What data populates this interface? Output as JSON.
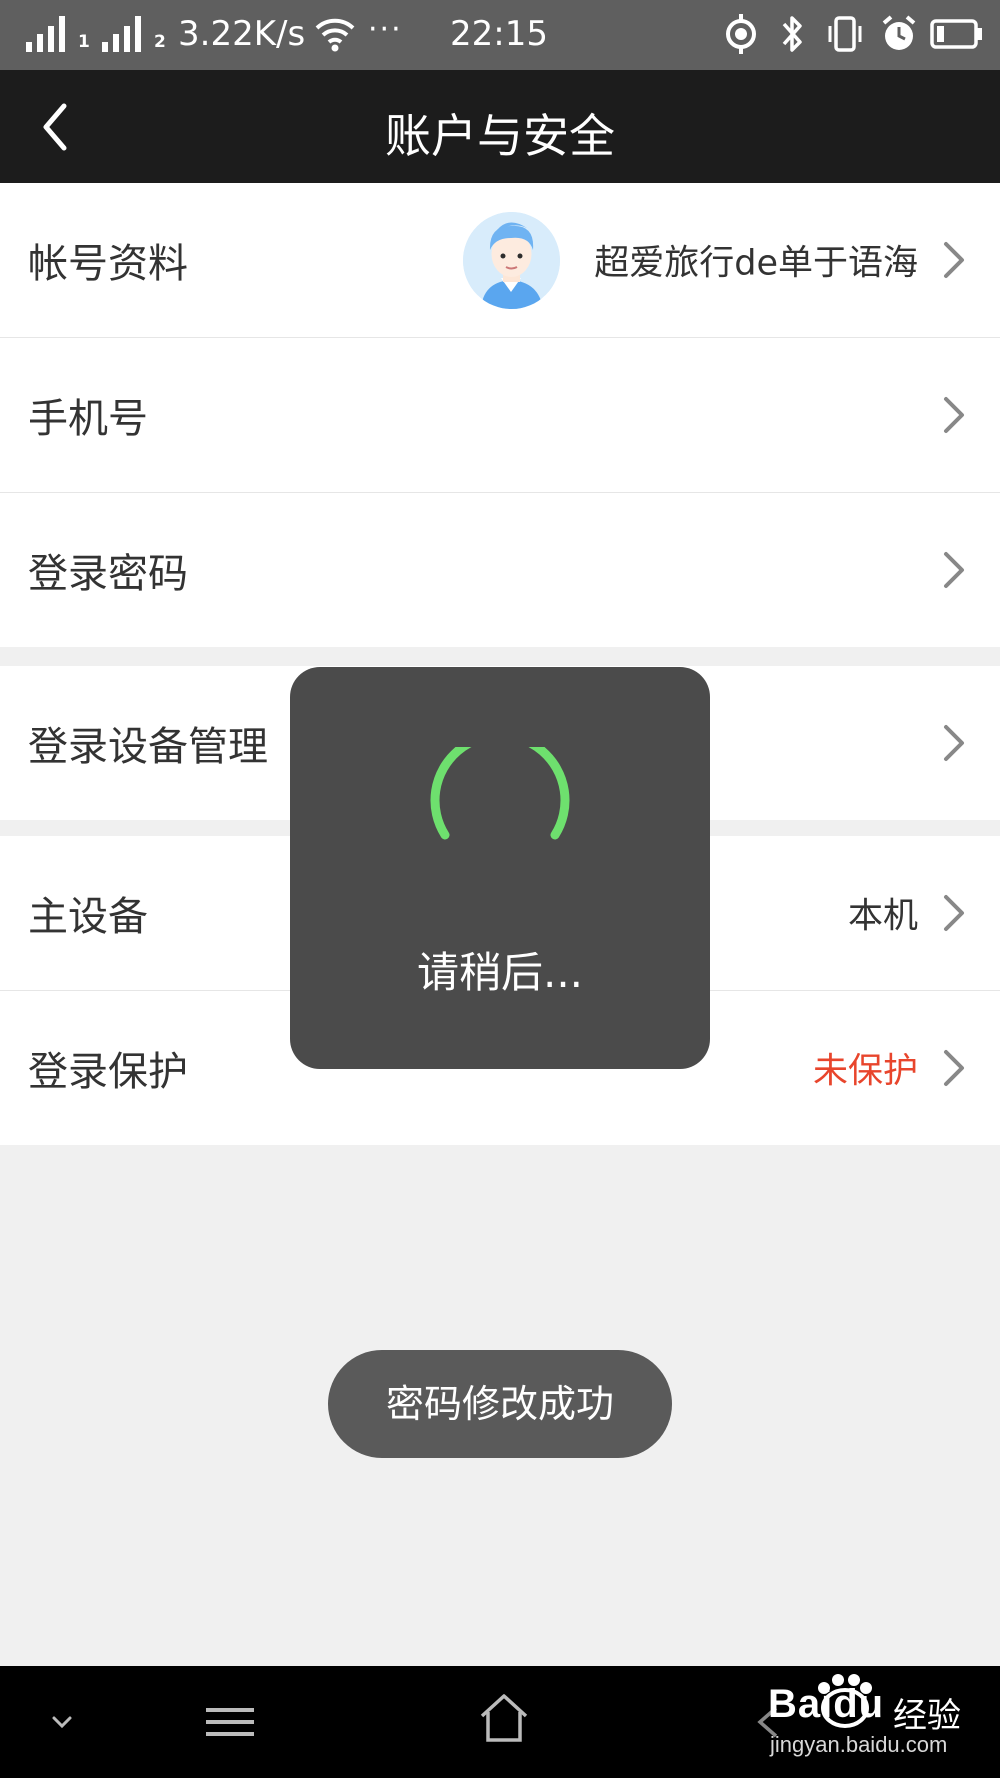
{
  "status_bar": {
    "sim1": "1",
    "sim2": "2",
    "net_speed": "3.22K/s",
    "more": "···",
    "time": "22:15"
  },
  "nav": {
    "title": "账户与安全"
  },
  "rows": [
    {
      "label": "帐号资料",
      "value": "超爱旅行de单于语海"
    },
    {
      "label": "手机号",
      "value": ""
    },
    {
      "label": "登录密码",
      "value": ""
    },
    {
      "label": "登录设备管理",
      "value": ""
    },
    {
      "label": "主设备",
      "value": "本机"
    },
    {
      "label": "登录保护",
      "value": "未保护"
    }
  ],
  "loading": {
    "text": "请稍后..."
  },
  "toast": {
    "text": "密码修改成功"
  },
  "watermark": {
    "brand": "Baidu",
    "suffix": "经验",
    "url": "jingyan.baidu.com"
  },
  "colors": {
    "warning": "#e8452c",
    "spinner": "#6ee06e",
    "nav_bg": "#1c1c1c"
  }
}
